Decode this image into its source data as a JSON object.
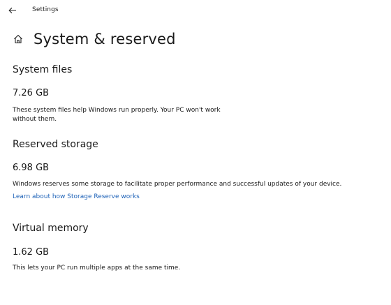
{
  "window": {
    "title": "Settings",
    "back_icon": "back-arrow-icon"
  },
  "header": {
    "home_icon": "home-icon",
    "title": "System & reserved"
  },
  "sections": [
    {
      "title": "System files",
      "size": "7.26 GB",
      "description_line1": "These system files help Windows run properly. Your PC won't work",
      "description_line2": "without them."
    },
    {
      "title": "Reserved storage",
      "size": "6.98 GB",
      "description_line1": "Windows reserves some storage to facilitate proper performance and successful updates of your device.",
      "link": "Learn about how Storage Reserve works"
    },
    {
      "title": "Virtual memory",
      "size": "1.62 GB",
      "description_line1": "This lets your PC run multiple apps at the same time."
    }
  ],
  "colors": {
    "link": "#1f63b8",
    "text": "#1a1a1a",
    "background": "#ffffff"
  }
}
